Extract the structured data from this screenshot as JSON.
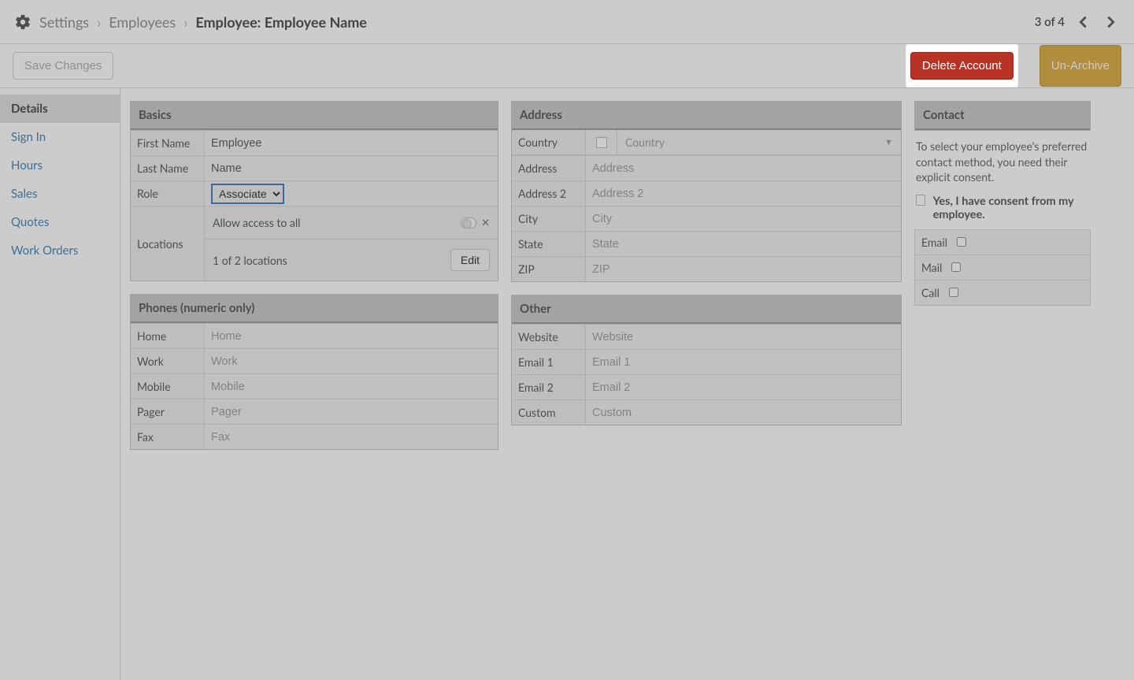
{
  "breadcrumb": {
    "root": "Settings",
    "parent": "Employees",
    "current": "Employee: Employee Name",
    "counter": "3 of 4"
  },
  "actions": {
    "save": "Save Changes",
    "delete": "Delete Account",
    "unarchive": "Un-Archive"
  },
  "sidebar": {
    "items": [
      {
        "label": "Details"
      },
      {
        "label": "Sign In"
      },
      {
        "label": "Hours"
      },
      {
        "label": "Sales"
      },
      {
        "label": "Quotes"
      },
      {
        "label": "Work Orders"
      }
    ]
  },
  "basics": {
    "header": "Basics",
    "first_name_label": "First Name",
    "first_name_value": "Employee",
    "last_name_label": "Last Name",
    "last_name_value": "Name",
    "role_label": "Role",
    "role_value": "Associate",
    "locations_label": "Locations",
    "allow_access_label": "Allow access to all",
    "locations_count": "1 of 2 locations",
    "edit_button": "Edit"
  },
  "phones": {
    "header": "Phones (numeric only)",
    "rows": [
      {
        "label": "Home",
        "placeholder": "Home"
      },
      {
        "label": "Work",
        "placeholder": "Work"
      },
      {
        "label": "Mobile",
        "placeholder": "Mobile"
      },
      {
        "label": "Pager",
        "placeholder": "Pager"
      },
      {
        "label": "Fax",
        "placeholder": "Fax"
      }
    ]
  },
  "address": {
    "header": "Address",
    "country_label": "Country",
    "country_placeholder": "Country",
    "rows": [
      {
        "label": "Address",
        "placeholder": "Address"
      },
      {
        "label": "Address 2",
        "placeholder": "Address 2"
      },
      {
        "label": "City",
        "placeholder": "City"
      },
      {
        "label": "State",
        "placeholder": "State"
      },
      {
        "label": "ZIP",
        "placeholder": "ZIP"
      }
    ]
  },
  "other": {
    "header": "Other",
    "rows": [
      {
        "label": "Website",
        "placeholder": "Website"
      },
      {
        "label": "Email 1",
        "placeholder": "Email 1"
      },
      {
        "label": "Email 2",
        "placeholder": "Email 2"
      },
      {
        "label": "Custom",
        "placeholder": "Custom"
      }
    ]
  },
  "contact": {
    "header": "Contact",
    "description": "To select your employee's preferred contact method, you need their explicit consent.",
    "consent_label": "Yes, I have consent from my employee.",
    "methods": [
      {
        "label": "Email"
      },
      {
        "label": "Mail"
      },
      {
        "label": "Call"
      }
    ]
  }
}
